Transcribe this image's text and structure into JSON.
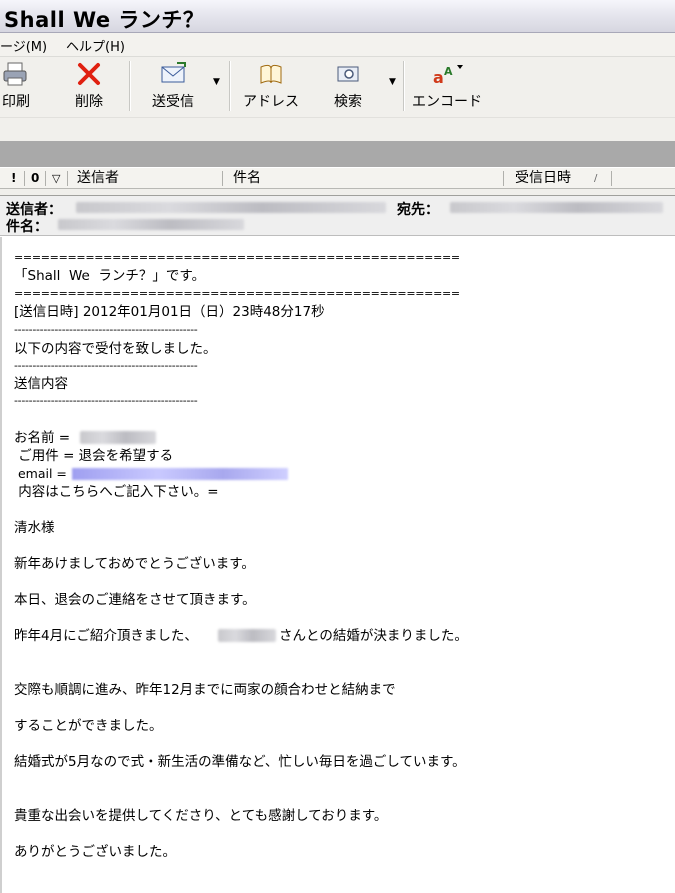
{
  "window": {
    "title": "Shall We ランチ？"
  },
  "menu": {
    "items": [
      "ージ(M)",
      "ヘルプ(H)"
    ]
  },
  "toolbar": {
    "print": "印刷",
    "delete": "削除",
    "send_receive": "送受信",
    "address": "アドレス",
    "search": "検索",
    "encode": "エンコード"
  },
  "list_header": {
    "flag": "!",
    "attach": "0",
    "mark": "▽",
    "sender": "送信者",
    "subject": "件名",
    "received": "受信日時",
    "sort_indicator": "/"
  },
  "preview": {
    "sender_label": "送信者：",
    "to_label": "宛先：",
    "subject_label": "件名："
  },
  "body": {
    "rule_eq": "==================================================",
    "rule_dash": "--------------------------------------------------",
    "line_intro": "「Shall  We  ランチ？」です。",
    "line_datetime": "[送信日時] 2012年01月01日（日）23時48分17秒",
    "line_accepted": "以下の内容で受付を致しました。",
    "line_contents": "送信内容",
    "field_name": "お名前 = ",
    "field_request": " ご用件 = 退会を希望する",
    "field_email": " email = ",
    "field_content": " 内容はこちらへご記入下さい。=",
    "p1": "清水様",
    "p2": "新年あけましておめでとうございます。",
    "p3": "本日、退会のご連絡をさせて頂きます。",
    "p4_pre": "昨年4月にご紹介頂きました、",
    "p4_post": "さんとの結婚が決まりました。",
    "p5": "交際も順調に進み、昨年12月までに両家の顔合わせと結納まで",
    "p6": "することができました。",
    "p7": "結婚式が5月なので式・新生活の準備など、忙しい毎日を過ごしています。",
    "p8": "貴重な出会いを提供してくださり、とても感謝しております。",
    "p9": "ありがとうございました。"
  }
}
